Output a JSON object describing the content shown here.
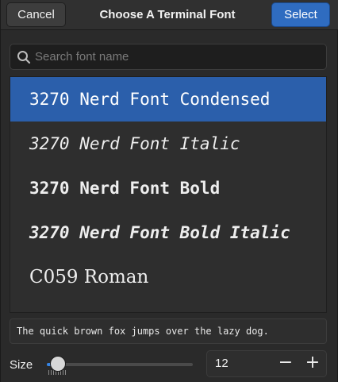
{
  "header": {
    "title": "Choose A Terminal Font",
    "cancel_label": "Cancel",
    "select_label": "Select"
  },
  "search": {
    "placeholder": "Search font name",
    "icon": "search-icon"
  },
  "fonts": [
    {
      "label": "3270 Nerd Font Condensed",
      "selected": true
    },
    {
      "label": "3270 Nerd Font Italic",
      "selected": false
    },
    {
      "label": "3270 Nerd Font Bold",
      "selected": false
    },
    {
      "label": "3270 Nerd Font Bold Italic",
      "selected": false
    },
    {
      "label": "C059 Roman",
      "selected": false
    }
  ],
  "preview": {
    "text": "The quick brown fox jumps over the lazy dog."
  },
  "size": {
    "label": "Size",
    "value": "12",
    "minus": "−",
    "plus": "+"
  },
  "colors": {
    "accent": "#3584e4",
    "selected_row": "#2b5fab"
  }
}
